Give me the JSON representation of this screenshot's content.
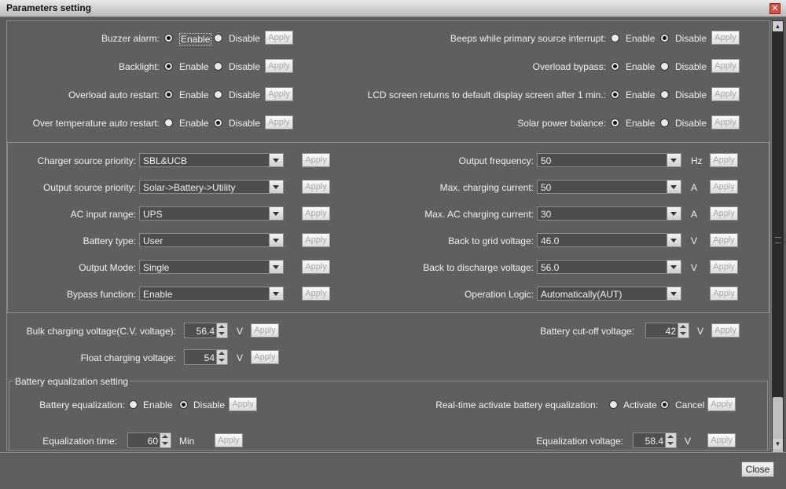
{
  "window": {
    "title": "Parameters setting",
    "close_glyph": "✕",
    "close_label": "Close"
  },
  "common": {
    "apply": "Apply",
    "enable": "Enable",
    "disable": "Disable"
  },
  "section1": {
    "buzzer_alarm": {
      "label": "Buzzer alarm:",
      "selected": "Enable"
    },
    "backlight": {
      "label": "Backlight:",
      "selected": "Enable"
    },
    "overload_auto_restart": {
      "label": "Overload auto restart:",
      "selected": "Enable"
    },
    "over_temp_auto_restart": {
      "label": "Over temperature auto restart:",
      "selected": "Disable"
    },
    "beeps_primary_interrupt": {
      "label": "Beeps while primary source interrupt:",
      "selected": "Disable"
    },
    "overload_bypass": {
      "label": "Overload bypass:",
      "selected": "Enable"
    },
    "lcd_return": {
      "label": "LCD screen returns to default display screen after 1 min.:",
      "selected": "Enable"
    },
    "solar_power_balance": {
      "label": "Solar power balance:",
      "selected": "Enable"
    }
  },
  "section2": {
    "charger_source_priority": {
      "label": "Charger source priority:",
      "value": "SBL&UCB"
    },
    "output_source_priority": {
      "label": "Output source priority:",
      "value": "Solar->Battery->Utility"
    },
    "ac_input_range": {
      "label": "AC input range:",
      "value": "UPS"
    },
    "battery_type": {
      "label": "Battery type:",
      "value": "User"
    },
    "output_mode": {
      "label": "Output Mode:",
      "value": "Single"
    },
    "bypass_function": {
      "label": "Bypass function:",
      "value": "Enable"
    },
    "output_frequency": {
      "label": "Output frequency:",
      "value": "50",
      "unit": "Hz"
    },
    "max_charging_current": {
      "label": "Max. charging current:",
      "value": "50",
      "unit": "A"
    },
    "max_ac_charging_current": {
      "label": "Max. AC charging current:",
      "value": "30",
      "unit": "A"
    },
    "back_to_grid_voltage": {
      "label": "Back to grid voltage:",
      "value": "46.0",
      "unit": "V"
    },
    "back_to_discharge_voltage": {
      "label": "Back to discharge voltage:",
      "value": "56.0",
      "unit": "V"
    },
    "operation_logic": {
      "label": "Operation Logic:",
      "value": "Automatically(AUT)"
    }
  },
  "section3": {
    "bulk_charging_voltage": {
      "label": "Bulk charging voltage(C.V. voltage):",
      "value": "56.4",
      "unit": "V"
    },
    "float_charging_voltage": {
      "label": "Float charging voltage:",
      "value": "54",
      "unit": "V"
    },
    "battery_cutoff_voltage": {
      "label": "Battery cut-off voltage:",
      "value": "42",
      "unit": "V"
    }
  },
  "equalization": {
    "group_title": "Battery equalization setting",
    "battery_equalization": {
      "label": "Battery equalization:",
      "selected": "Disable"
    },
    "realtime_activate": {
      "label": "Real-time activate battery equalization:",
      "option1": "Activate",
      "option2": "Cancel",
      "selected": "Cancel"
    },
    "equalization_time": {
      "label": "Equalization time:",
      "value": "60",
      "unit": "Min"
    },
    "equalization_voltage": {
      "label": "Equalization voltage:",
      "value": "58.4",
      "unit": "V"
    }
  }
}
